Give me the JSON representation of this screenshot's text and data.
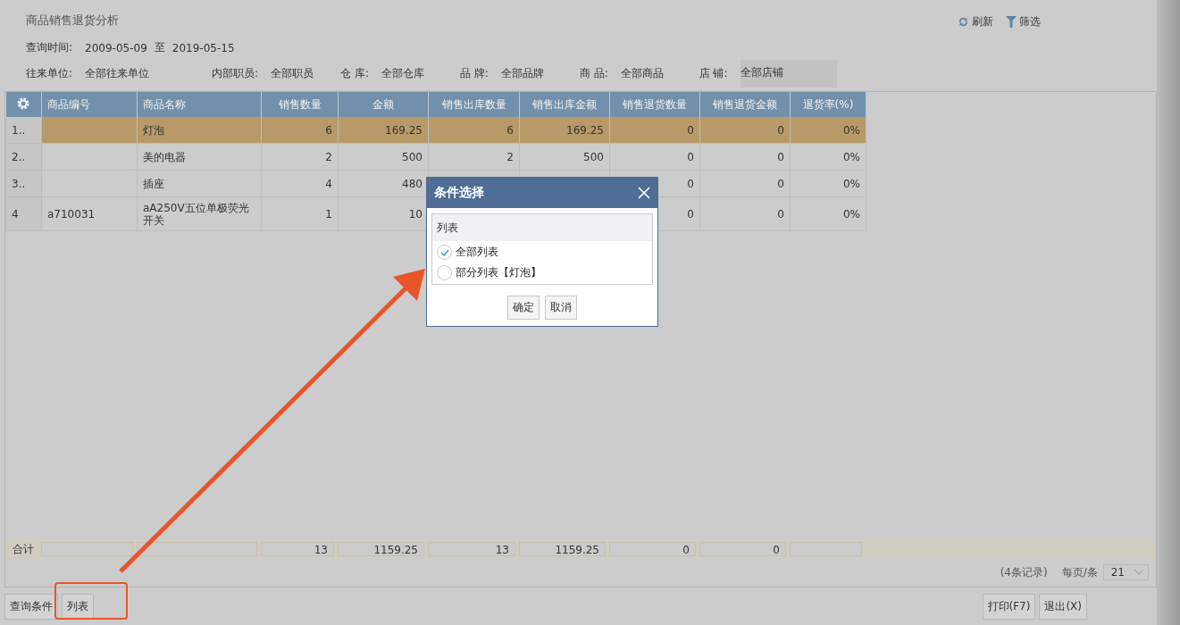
{
  "title": "商品销售退货分析",
  "toolbar": [
    {
      "kind": "refresh",
      "label": "刷新"
    },
    {
      "kind": "filter",
      "label": "筛选"
    }
  ],
  "query_time": {
    "label": "查询时间:",
    "from": "2009-05-09",
    "separator": "至",
    "to": "2019-05-15"
  },
  "filters": [
    {
      "label": "往来单位:",
      "value": "全部往来单位",
      "kind": "text"
    },
    {
      "label": "内部职员:",
      "value": "全部职员",
      "kind": "text"
    },
    {
      "label": "仓 库:",
      "value": "全部仓库",
      "kind": "text"
    },
    {
      "label": "品 牌:",
      "value": "全部品牌",
      "kind": "text"
    },
    {
      "label": "商 品:",
      "value": "全部商品",
      "kind": "text"
    },
    {
      "label": "店 铺:",
      "value": "全部店铺",
      "kind": "field"
    }
  ],
  "table": {
    "columns": [
      "商品编号",
      "商品名称",
      "销售数量",
      "金额",
      "销售出库数量",
      "销售出库金额",
      "销售退货数量",
      "销售退货金额",
      "退货率(%)"
    ],
    "rows": [
      {
        "index": "1..",
        "selected": true,
        "cells": [
          null,
          "灯泡",
          "6",
          "169.25",
          "6",
          "169.25",
          "0",
          "0",
          "0%"
        ]
      },
      {
        "index": "2..",
        "selected": false,
        "cells": [
          null,
          "美的电器",
          "2",
          "500",
          "2",
          "500",
          "0",
          "0",
          "0%"
        ]
      },
      {
        "index": "3..",
        "selected": false,
        "cells": [
          null,
          "插座",
          "4",
          "480",
          null,
          null,
          "0",
          "0",
          "0%"
        ]
      },
      {
        "index": "4",
        "selected": false,
        "cells": [
          "a710031",
          "aA250V五位单极荧光开关",
          "1",
          "10",
          null,
          null,
          "0",
          "0",
          "0%"
        ]
      }
    ],
    "totals": {
      "label": "合计",
      "cells": [
        null,
        null,
        "13",
        "1159.25",
        "13",
        "1159.25",
        "0",
        "0",
        null
      ]
    }
  },
  "pagination": {
    "records": "(4条记录)",
    "per_page_label": "每页/条",
    "per_page": "21"
  },
  "bottom_left_buttons": [
    "查询条件",
    "列表"
  ],
  "bottom_right_buttons": [
    "打印(F7)",
    "退出(X)"
  ],
  "dialog": {
    "title": "条件选择",
    "group_label": "列表",
    "options": [
      {
        "label": "全部列表",
        "selected": true
      },
      {
        "label": "部分列表【灯泡】",
        "selected": false
      }
    ],
    "buttons": [
      "确定",
      "取消"
    ]
  }
}
